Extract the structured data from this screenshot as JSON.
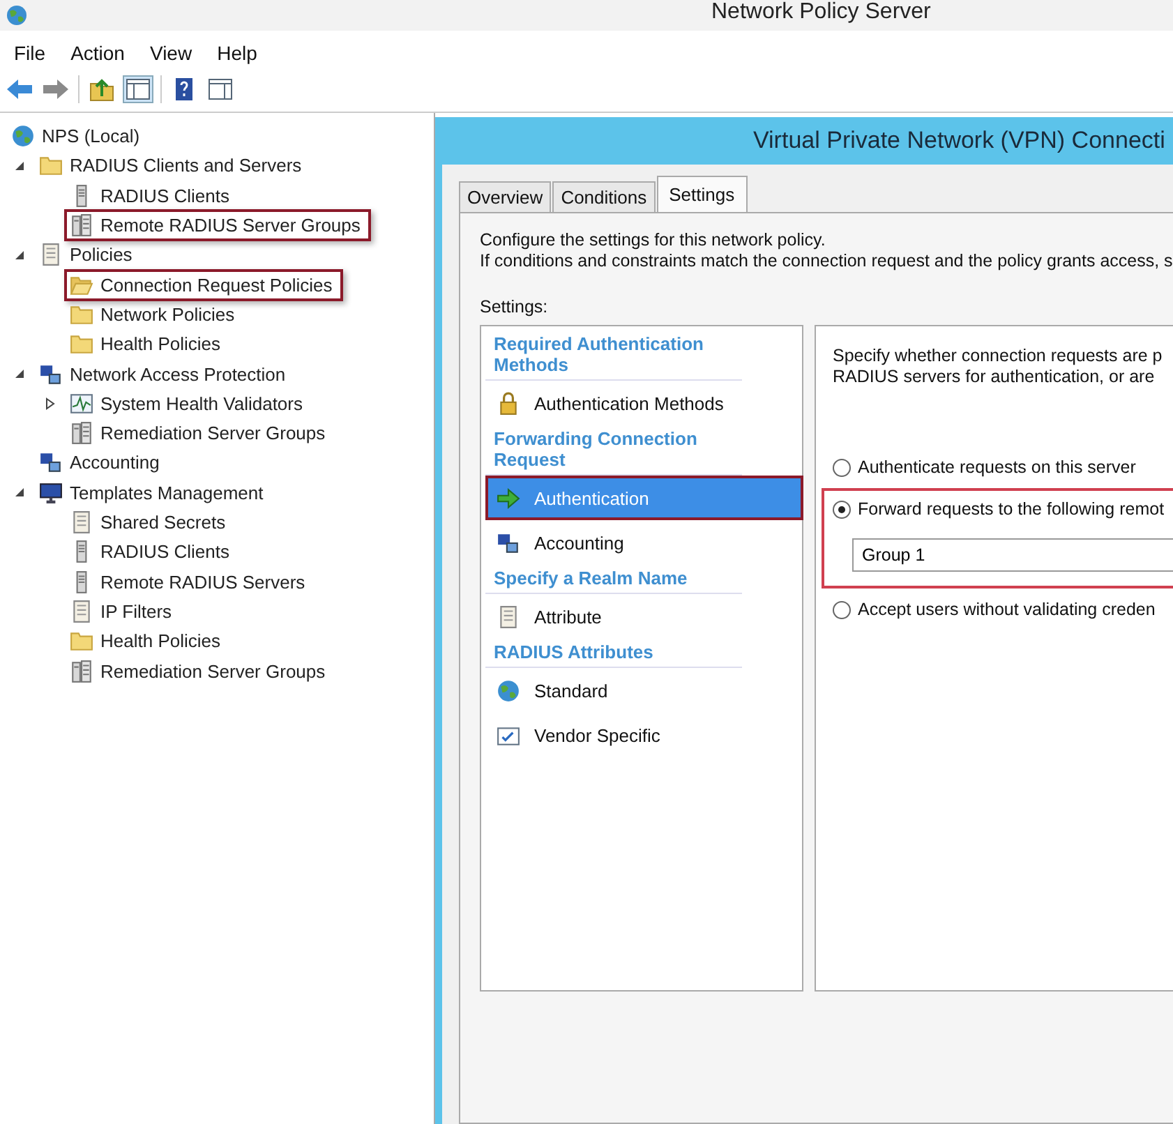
{
  "window": {
    "title": "Network Policy Server"
  },
  "menu": [
    "File",
    "Action",
    "View",
    "Help"
  ],
  "tree": [
    {
      "label": "NPS (Local)",
      "kind": "globe",
      "highlighted": false,
      "children": [
        {
          "label": "RADIUS Clients and Servers",
          "kind": "folder",
          "expanded": true,
          "highlighted": false,
          "children": [
            {
              "label": "RADIUS Clients",
              "kind": "server",
              "highlighted": false
            },
            {
              "label": "Remote RADIUS Server Groups",
              "kind": "servers",
              "highlighted": true
            }
          ]
        },
        {
          "label": "Policies",
          "kind": "document",
          "expanded": true,
          "highlighted": false,
          "children": [
            {
              "label": "Connection Request Policies",
              "kind": "folder-open",
              "highlighted": true
            },
            {
              "label": "Network Policies",
              "kind": "folder",
              "highlighted": false
            },
            {
              "label": "Health Policies",
              "kind": "folder",
              "highlighted": false
            }
          ]
        },
        {
          "label": "Network Access Protection",
          "kind": "network",
          "expanded": true,
          "highlighted": false,
          "children": [
            {
              "label": "System Health Validators",
              "kind": "chart",
              "expanded": false,
              "highlighted": false
            },
            {
              "label": "Remediation Server Groups",
              "kind": "servers",
              "highlighted": false
            }
          ]
        },
        {
          "label": "Accounting",
          "kind": "network",
          "highlighted": false
        },
        {
          "label": "Templates Management",
          "kind": "monitor",
          "expanded": true,
          "highlighted": false,
          "children": [
            {
              "label": "Shared Secrets",
              "kind": "document",
              "highlighted": false
            },
            {
              "label": "RADIUS Clients",
              "kind": "server",
              "highlighted": false
            },
            {
              "label": "Remote RADIUS Servers",
              "kind": "server",
              "highlighted": false
            },
            {
              "label": "IP Filters",
              "kind": "document",
              "highlighted": false
            },
            {
              "label": "Health Policies",
              "kind": "folder",
              "highlighted": false
            },
            {
              "label": "Remediation Server Groups",
              "kind": "servers",
              "highlighted": false
            }
          ]
        }
      ]
    }
  ],
  "dialog": {
    "title": "Virtual Private Network (VPN) Connecti",
    "tabs": [
      {
        "label": "Overview",
        "selected": false
      },
      {
        "label": "Conditions",
        "selected": false
      },
      {
        "label": "Settings",
        "selected": true
      }
    ],
    "intro": [
      "Configure the settings for this network policy.",
      "If conditions and constraints match the connection request and the policy grants access, s"
    ],
    "settings_label": "Settings:",
    "settings": [
      {
        "heading": "Required Authentication Methods",
        "items": [
          {
            "label": "Authentication Methods",
            "kind": "lock",
            "selected": false,
            "highlighted": false
          }
        ]
      },
      {
        "heading": "Forwarding Connection Request",
        "items": [
          {
            "label": "Authentication",
            "kind": "arrow",
            "selected": true,
            "highlighted": true
          },
          {
            "label": "Accounting",
            "kind": "network",
            "selected": false,
            "highlighted": false
          }
        ]
      },
      {
        "heading": "Specify a Realm Name",
        "items": [
          {
            "label": "Attribute",
            "kind": "document",
            "selected": false,
            "highlighted": false
          }
        ]
      },
      {
        "heading": "RADIUS Attributes",
        "items": [
          {
            "label": "Standard",
            "kind": "globe",
            "selected": false,
            "highlighted": false
          },
          {
            "label": "Vendor Specific",
            "kind": "check",
            "selected": false,
            "highlighted": false
          }
        ]
      }
    ],
    "detail": {
      "description": [
        "Specify whether connection requests are p",
        "RADIUS servers for authentication, or are"
      ],
      "options": [
        {
          "label": "Authenticate requests on this server",
          "selected": false,
          "highlighted": false
        },
        {
          "label": "Forward requests to the following remot",
          "selected": true,
          "highlighted": true,
          "field": "Group 1"
        },
        {
          "label": "Accept users without validating creden",
          "selected": false,
          "highlighted": false
        }
      ]
    }
  }
}
